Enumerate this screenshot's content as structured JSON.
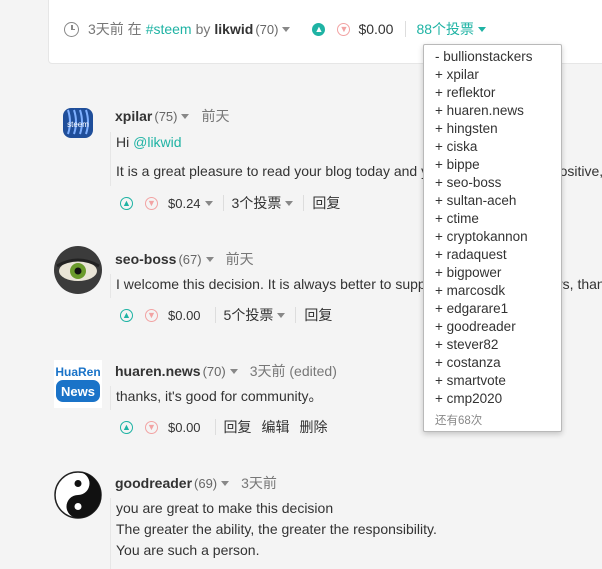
{
  "post": {
    "time": "3天前 在",
    "tag": "#steem",
    "by": "by",
    "author": "likwid",
    "rep": "(70)",
    "payout": "$0.00",
    "votes_label": "88个投票"
  },
  "voters": {
    "items": [
      "- bullionstackers",
      "+ xpilar",
      "+ reflektor",
      "+ huaren.news",
      "+ hingsten",
      "+ ciska",
      "+ bippe",
      "+ seo-boss",
      "+ sultan-aceh",
      "+ ctime",
      "+ cryptokannon",
      "+ radaquest",
      "+ bigpower",
      "+ marcosdk",
      "+ edgarare1",
      "+ goodreader",
      "+ stever82",
      "+ costanza",
      "+ smartvote",
      "+ cmp2020"
    ],
    "more": "还有68次"
  },
  "comments": [
    {
      "author": "xpilar",
      "rep": "(75)",
      "time": "前天",
      "line1_prefix": "Hi ",
      "mention": "@likwid",
      "line2": "It is a great pleasure to read your blog today and your decision is very positive, keep up",
      "payout": "$0.24",
      "votes": "3个投票",
      "reply": "回复"
    },
    {
      "author": "seo-boss",
      "rep": "(67)",
      "time": "前天",
      "line1": "I welcome this decision. It is always better to support the content creators, thank the boss",
      "payout": "$0.00",
      "votes": "5个投票",
      "reply": "回复"
    },
    {
      "author": "huaren.news",
      "rep": "(70)",
      "time": "3天前 (edited)",
      "line1": "thanks, it's good for community。",
      "payout": "$0.00",
      "reply": "回复",
      "edit": "编辑",
      "delete": "删除",
      "avatar_text_top": "HuaRen",
      "avatar_text_bottom": "News"
    },
    {
      "author": "goodreader",
      "rep": "(69)",
      "time": "3天前",
      "line1": "you are great to make this decision",
      "line2": "The greater the ability, the greater the responsibility.",
      "line3": "You are such a person."
    }
  ],
  "colors": {
    "accent": "#1fb3a4",
    "downvote": "#f2a3a3",
    "news_blue": "#1a73c8"
  }
}
